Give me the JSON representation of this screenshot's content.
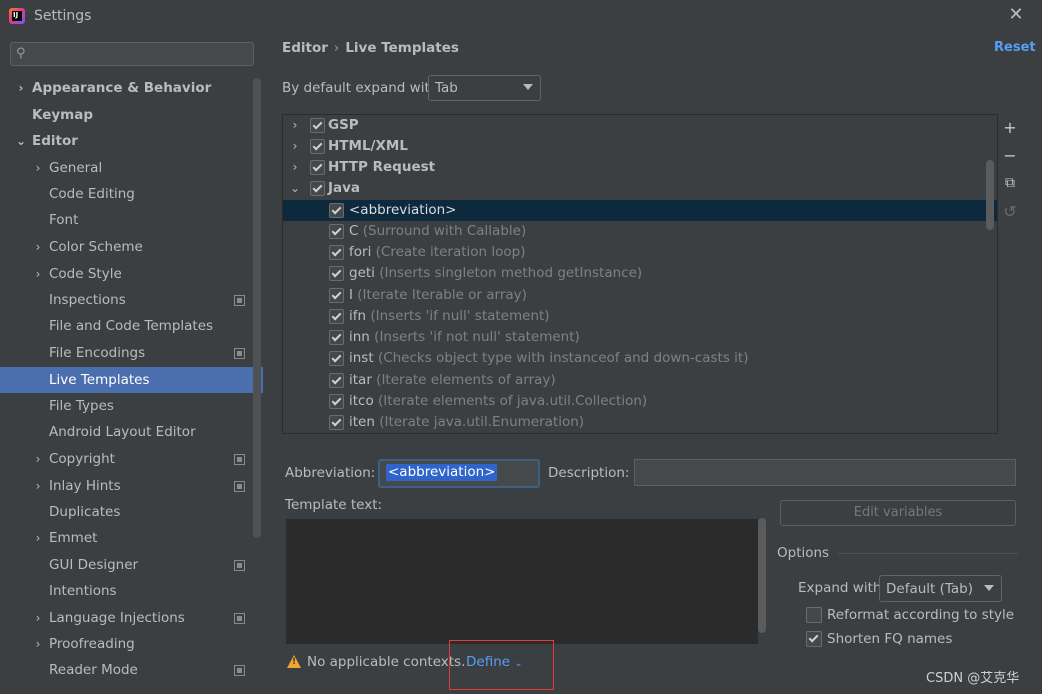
{
  "window": {
    "title": "Settings"
  },
  "sidebar": {
    "search_placeholder": "",
    "items": [
      {
        "label": "Appearance & Behavior"
      },
      {
        "label": "Keymap"
      },
      {
        "label": "Editor"
      },
      {
        "label": "General"
      },
      {
        "label": "Code Editing"
      },
      {
        "label": "Font"
      },
      {
        "label": "Color Scheme"
      },
      {
        "label": "Code Style"
      },
      {
        "label": "Inspections"
      },
      {
        "label": "File and Code Templates"
      },
      {
        "label": "File Encodings"
      },
      {
        "label": "Live Templates"
      },
      {
        "label": "File Types"
      },
      {
        "label": "Android Layout Editor"
      },
      {
        "label": "Copyright"
      },
      {
        "label": "Inlay Hints"
      },
      {
        "label": "Duplicates"
      },
      {
        "label": "Emmet"
      },
      {
        "label": "GUI Designer"
      },
      {
        "label": "Intentions"
      },
      {
        "label": "Language Injections"
      },
      {
        "label": "Proofreading"
      },
      {
        "label": "Reader Mode"
      }
    ]
  },
  "breadcrumb": {
    "parent": "Editor",
    "separator": "›",
    "current": "Live Templates"
  },
  "reset_label": "Reset",
  "expand_with": {
    "label": "By default expand with",
    "value": "Tab"
  },
  "tree": {
    "groups": [
      "GSP",
      "HTML/XML",
      "HTTP Request",
      "Java"
    ],
    "templates": [
      {
        "abbr": "<abbreviation>",
        "desc": ""
      },
      {
        "abbr": "C",
        "desc": "(Surround with Callable)"
      },
      {
        "abbr": "fori",
        "desc": "(Create iteration loop)"
      },
      {
        "abbr": "geti",
        "desc": "(Inserts singleton method getInstance)"
      },
      {
        "abbr": "I",
        "desc": "(Iterate Iterable or array)"
      },
      {
        "abbr": "ifn",
        "desc": "(Inserts 'if null' statement)"
      },
      {
        "abbr": "inn",
        "desc": "(Inserts 'if not null' statement)"
      },
      {
        "abbr": "inst",
        "desc": "(Checks object type with instanceof and down-casts it)"
      },
      {
        "abbr": "itar",
        "desc": "(Iterate elements of array)"
      },
      {
        "abbr": "itco",
        "desc": "(Iterate elements of java.util.Collection)"
      },
      {
        "abbr": "iten",
        "desc": "(Iterate java.util.Enumeration)"
      }
    ]
  },
  "editor": {
    "abbreviation_label": "Abbreviation:",
    "abbreviation_value": "<abbreviation>",
    "description_label": "Description:",
    "description_value": "",
    "template_text_label": "Template text:",
    "edit_variables_label": "Edit variables",
    "options_label": "Options",
    "expand_with_label": "Expand with",
    "expand_with_value": "Default (Tab)",
    "reformat_label": "Reformat according to style",
    "reformat_checked": false,
    "shorten_label": "Shorten FQ names",
    "shorten_checked": true,
    "context_warning": "No applicable contexts.",
    "define_label": "Define"
  },
  "watermark": "CSDN @艾克华",
  "colors": {
    "selection": "#4b6eaf",
    "link": "#589df6",
    "highlight_box": "#e33b3b",
    "warning": "#f0a732"
  }
}
